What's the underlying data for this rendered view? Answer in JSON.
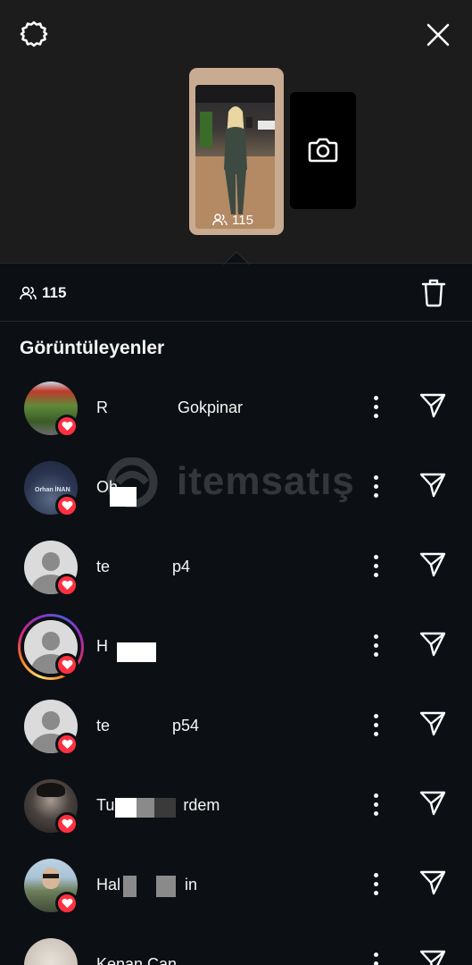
{
  "story": {
    "viewer_count": "115"
  },
  "summary": {
    "viewer_count": "115"
  },
  "section_title": "Görüntüleyenler",
  "viewers": [
    {
      "name_start": "R",
      "name_end": "Gokpinar",
      "photo": "outdoor"
    },
    {
      "name_start": "Oh",
      "name_end": "",
      "photo": "orhan"
    },
    {
      "name_start": "te",
      "name_end": "p4",
      "photo": "default"
    },
    {
      "name_start": "H",
      "name_end": "",
      "photo": "default",
      "story_ring": true
    },
    {
      "name_start": "te",
      "name_end": "p54",
      "photo": "default"
    },
    {
      "name_start": "Tu",
      "name_end": "rdem",
      "photo": "portrait"
    },
    {
      "name_start": "Hal",
      "name_end": "in",
      "photo": "sunglasses"
    },
    {
      "name_start": "Kenan Can",
      "name_end": "",
      "photo": "light"
    }
  ],
  "watermark": {
    "brand": "itemsatış"
  },
  "colors": {
    "background": "#0c1014",
    "top_panel": "#1c1c1c",
    "heart": "#ff3040",
    "story_frame": "#c9ab92"
  },
  "icons": [
    "settings-icon",
    "close-icon",
    "camera-icon",
    "viewers-icon",
    "trash-icon",
    "more-icon",
    "send-icon",
    "heart-icon"
  ]
}
